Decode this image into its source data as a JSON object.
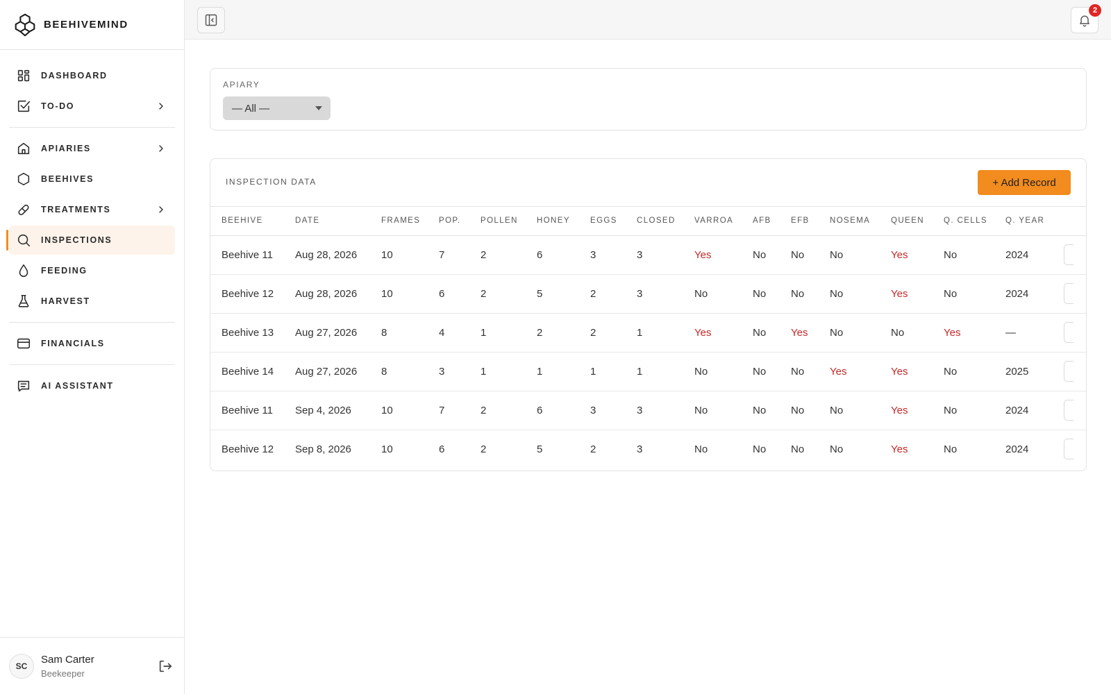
{
  "brand": {
    "name": "BEEHIVEMIND"
  },
  "sidebar": {
    "groups": [
      [
        {
          "label": "DASHBOARD",
          "icon": "dashboard-icon",
          "chevron": false,
          "active": false
        },
        {
          "label": "TO-DO",
          "icon": "checkbox-icon",
          "chevron": true,
          "active": false
        }
      ],
      [
        {
          "label": "APIARIES",
          "icon": "home-icon",
          "chevron": true,
          "active": false
        },
        {
          "label": "BEEHIVES",
          "icon": "hexagon-icon",
          "chevron": false,
          "active": false
        },
        {
          "label": "TREATMENTS",
          "icon": "pill-icon",
          "chevron": true,
          "active": false
        },
        {
          "label": "INSPECTIONS",
          "icon": "search-icon",
          "chevron": false,
          "active": true
        },
        {
          "label": "FEEDING",
          "icon": "droplet-icon",
          "chevron": false,
          "active": false
        },
        {
          "label": "HARVEST",
          "icon": "flask-icon",
          "chevron": false,
          "active": false
        }
      ],
      [
        {
          "label": "FINANCIALS",
          "icon": "credit-card-icon",
          "chevron": false,
          "active": false
        }
      ],
      [
        {
          "label": "AI ASSISTANT",
          "icon": "chat-icon",
          "chevron": false,
          "active": false
        }
      ]
    ]
  },
  "user": {
    "initials": "SC",
    "name": "Sam Carter",
    "role": "Beekeeper"
  },
  "topbar": {
    "notification_count": "2"
  },
  "filter": {
    "label": "APIARY",
    "selected": "— All —"
  },
  "inspections": {
    "title": "INSPECTION DATA",
    "add_label": "+ Add Record",
    "columns": [
      "BEEHIVE",
      "DATE",
      "FRAMES",
      "POP.",
      "POLLEN",
      "HONEY",
      "EGGS",
      "CLOSED",
      "VARROA",
      "AFB",
      "EFB",
      "NOSEMA",
      "QUEEN",
      "Q. CELLS",
      "Q. YEAR"
    ],
    "rows": [
      [
        "Beehive 11",
        "Aug 28, 2026",
        "10",
        "7",
        "2",
        "6",
        "3",
        "3",
        "Yes",
        "No",
        "No",
        "No",
        "Yes",
        "No",
        "2024"
      ],
      [
        "Beehive 12",
        "Aug 28, 2026",
        "10",
        "6",
        "2",
        "5",
        "2",
        "3",
        "No",
        "No",
        "No",
        "No",
        "Yes",
        "No",
        "2024"
      ],
      [
        "Beehive 13",
        "Aug 27, 2026",
        "8",
        "4",
        "1",
        "2",
        "2",
        "1",
        "Yes",
        "No",
        "Yes",
        "No",
        "No",
        "Yes",
        "—"
      ],
      [
        "Beehive 14",
        "Aug 27, 2026",
        "8",
        "3",
        "1",
        "1",
        "1",
        "1",
        "No",
        "No",
        "No",
        "Yes",
        "Yes",
        "No",
        "2025"
      ],
      [
        "Beehive 11",
        "Sep 4, 2026",
        "10",
        "7",
        "2",
        "6",
        "3",
        "3",
        "No",
        "No",
        "No",
        "No",
        "Yes",
        "No",
        "2024"
      ],
      [
        "Beehive 12",
        "Sep 8, 2026",
        "10",
        "6",
        "2",
        "5",
        "2",
        "3",
        "No",
        "No",
        "No",
        "No",
        "Yes",
        "No",
        "2024"
      ]
    ]
  },
  "colors": {
    "accent": "#f28c1e",
    "alert": "#c62828",
    "badge": "#e02525",
    "active_bg": "#fdf3ea"
  }
}
